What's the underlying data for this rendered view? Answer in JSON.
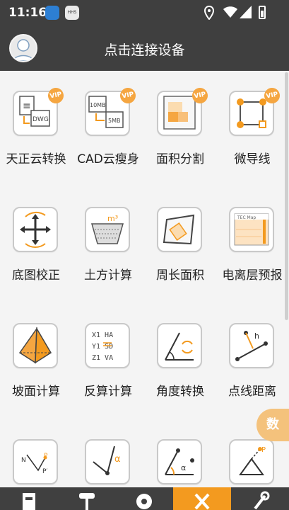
{
  "status_bar": {
    "time": "11:16",
    "notif2_text": "HHS"
  },
  "header": {
    "title": "点击连接设备"
  },
  "vip_badge": "VIP",
  "tools": [
    {
      "label": "天正云转换",
      "icon": "dwg-convert-icon",
      "vip": true,
      "icon_text": "DWG"
    },
    {
      "label": "CAD云瘦身",
      "icon": "cad-slim-icon",
      "vip": true,
      "icon_text_a": "10MB",
      "icon_text_b": "5MB"
    },
    {
      "label": "面积分割",
      "icon": "area-split-icon",
      "vip": true
    },
    {
      "label": "微导线",
      "icon": "micro-traverse-icon",
      "vip": true
    },
    {
      "label": "底图校正",
      "icon": "basemap-correct-icon",
      "vip": false
    },
    {
      "label": "土方计算",
      "icon": "earthwork-icon",
      "vip": false,
      "icon_text": "m³"
    },
    {
      "label": "周长面积",
      "icon": "perimeter-area-icon",
      "vip": false
    },
    {
      "label": "电离层预报",
      "icon": "ionosphere-map-icon",
      "vip": false,
      "icon_text": "TEC Map"
    },
    {
      "label": "坡面计算",
      "icon": "slope-pyramid-icon",
      "vip": false
    },
    {
      "label": "反算计算",
      "icon": "inverse-calc-icon",
      "vip": false,
      "lines": [
        "X1  HA",
        "Y1  SD",
        "Z1  VA"
      ]
    },
    {
      "label": "角度转换",
      "icon": "angle-convert-icon",
      "vip": false
    },
    {
      "label": "点线距离",
      "icon": "point-line-distance-icon",
      "vip": false,
      "icon_text": "h"
    },
    {
      "label": "",
      "icon": "point-projection-icon",
      "vip": false,
      "icon_text_a": "N",
      "icon_text_b": "P",
      "icon_text_c": "P′"
    },
    {
      "label": "",
      "icon": "alpha-angle-icon",
      "vip": false,
      "icon_text": "α"
    },
    {
      "label": "",
      "icon": "point-angle-icon",
      "vip": false,
      "icon_text": "α"
    },
    {
      "label": "",
      "icon": "triangle-point-icon",
      "vip": false,
      "icon_text": "P"
    }
  ],
  "float_button": "数",
  "bottom_nav": [
    {
      "name": "survey-tab",
      "active": false
    },
    {
      "name": "device-tab",
      "active": false
    },
    {
      "name": "settings-tab",
      "active": false
    },
    {
      "name": "tools-tab",
      "active": true
    },
    {
      "name": "service-tab",
      "active": false
    }
  ],
  "colors": {
    "accent": "#f39a1f",
    "bar": "#3f3f3f"
  }
}
